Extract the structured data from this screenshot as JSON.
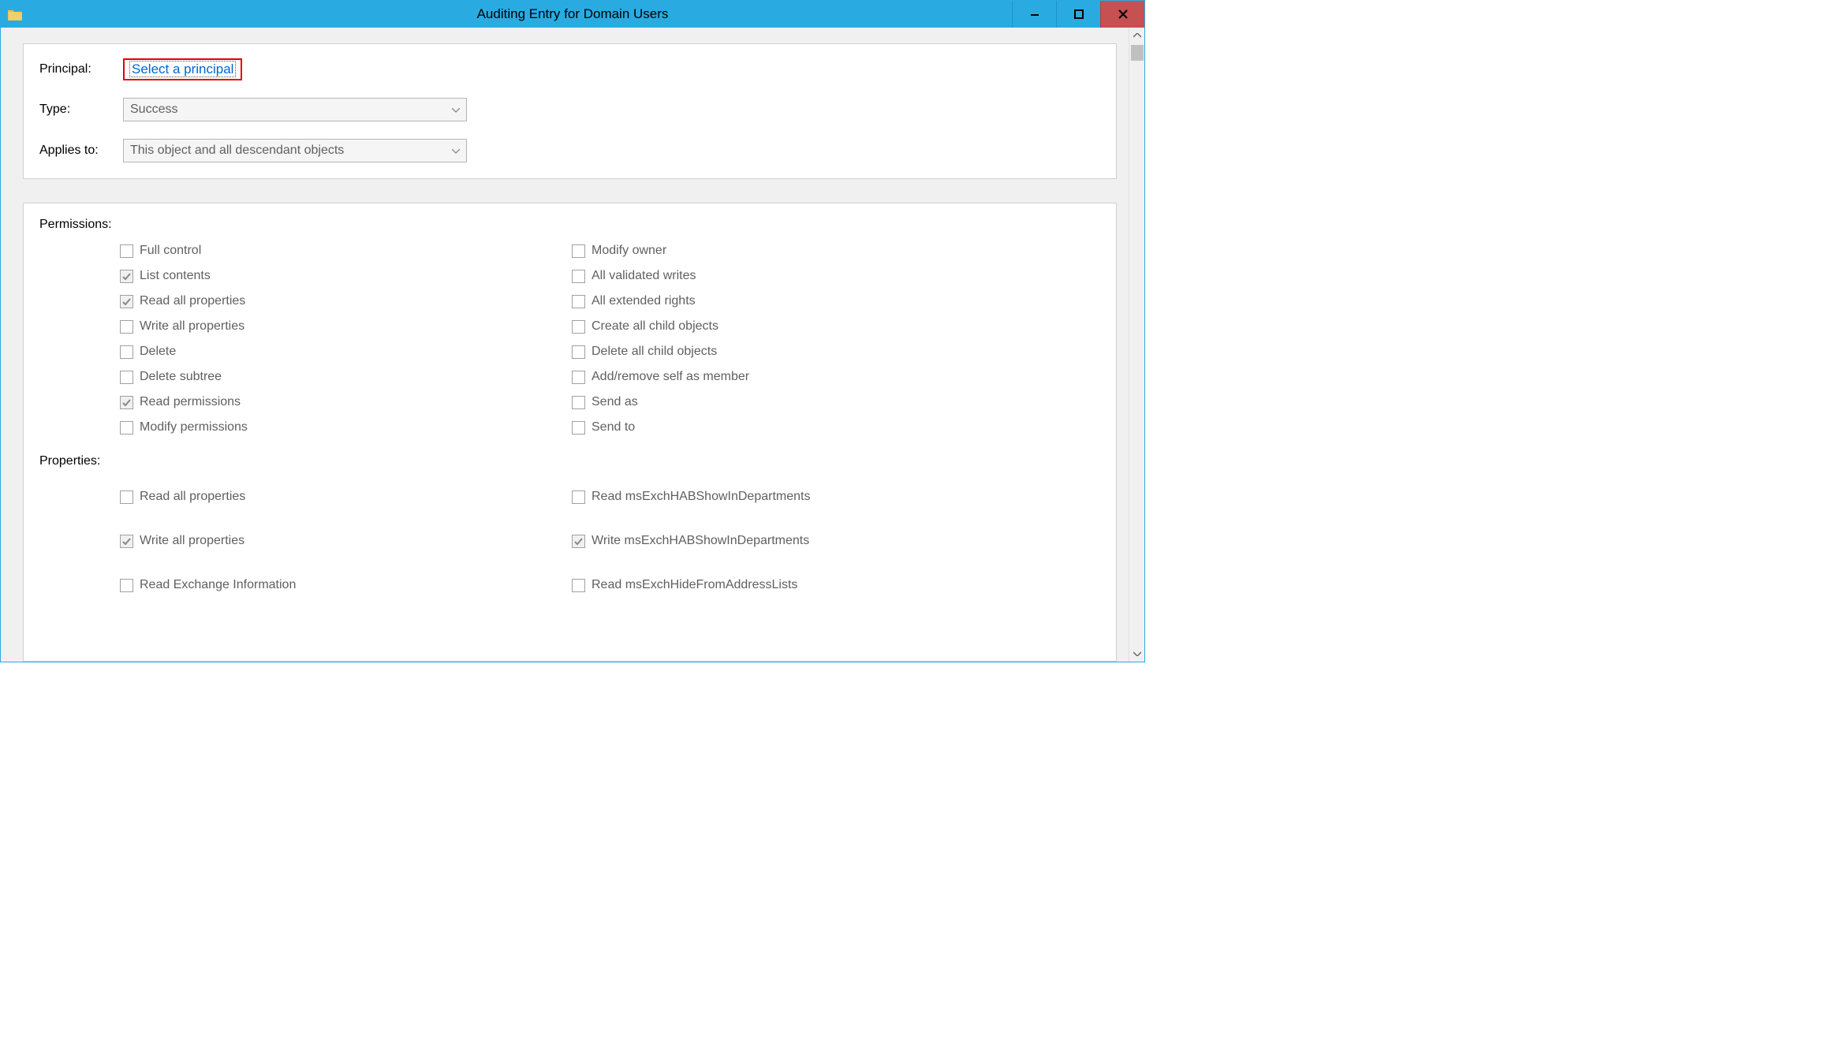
{
  "window": {
    "title": "Auditing Entry for Domain Users"
  },
  "top_panel": {
    "principal_label": "Principal:",
    "principal_link": "Select a principal",
    "type_label": "Type:",
    "type_value": "Success",
    "applies_label": "Applies to:",
    "applies_value": "This object and all descendant objects"
  },
  "permissions": {
    "heading": "Permissions:",
    "left": [
      {
        "label": "Full control",
        "checked": false
      },
      {
        "label": "List contents",
        "checked": true
      },
      {
        "label": "Read all properties",
        "checked": true
      },
      {
        "label": "Write all properties",
        "checked": false
      },
      {
        "label": "Delete",
        "checked": false
      },
      {
        "label": "Delete subtree",
        "checked": false
      },
      {
        "label": "Read permissions",
        "checked": true
      },
      {
        "label": "Modify permissions",
        "checked": false
      }
    ],
    "right": [
      {
        "label": "Modify owner",
        "checked": false
      },
      {
        "label": "All validated writes",
        "checked": false
      },
      {
        "label": "All extended rights",
        "checked": false
      },
      {
        "label": "Create all child objects",
        "checked": false
      },
      {
        "label": "Delete all child objects",
        "checked": false
      },
      {
        "label": "Add/remove self as member",
        "checked": false
      },
      {
        "label": "Send as",
        "checked": false
      },
      {
        "label": "Send to",
        "checked": false
      }
    ]
  },
  "properties": {
    "heading": "Properties:",
    "left": [
      {
        "label": "Read all properties",
        "checked": false
      },
      {
        "label": "Write all properties",
        "checked": true
      },
      {
        "label": "Read Exchange Information",
        "checked": false
      }
    ],
    "right": [
      {
        "label": "Read msExchHABShowInDepartments",
        "checked": false
      },
      {
        "label": "Write msExchHABShowInDepartments",
        "checked": true
      },
      {
        "label": "Read msExchHideFromAddressLists",
        "checked": false
      }
    ]
  }
}
